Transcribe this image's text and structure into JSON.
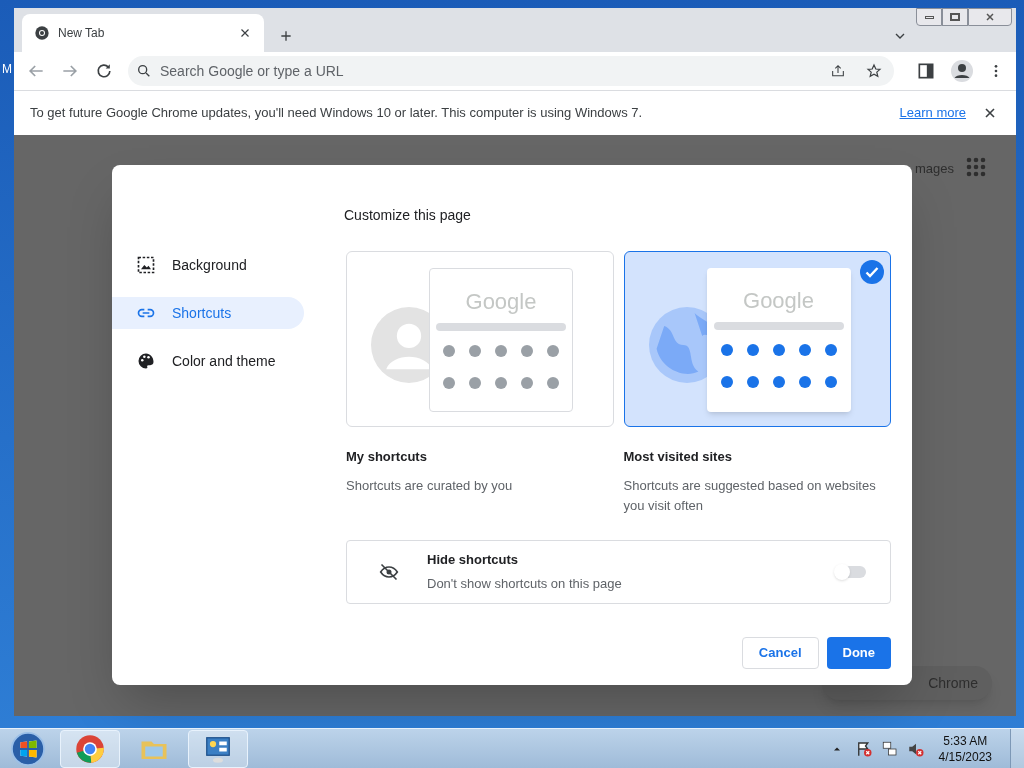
{
  "desktop": {
    "icon_label": "M"
  },
  "browser": {
    "tabs": [
      {
        "title": "New Tab",
        "selected": true
      }
    ],
    "omnibox": {
      "placeholder": "Search Google or type a URL"
    },
    "infobar": {
      "message": "To get future Google Chrome updates, you'll need Windows 10 or later. This computer is using Windows 7.",
      "link": "Learn more"
    }
  },
  "page": {
    "header_links": [
      "mages"
    ],
    "customize_button": "Chrome"
  },
  "dialog": {
    "title": "Customize this page",
    "nav": [
      {
        "label": "Background",
        "kind": "image",
        "selected": false
      },
      {
        "label": "Shortcuts",
        "kind": "link",
        "selected": true
      },
      {
        "label": "Color and theme",
        "kind": "palette",
        "selected": false
      }
    ],
    "options": [
      {
        "kind": "person",
        "logo_text": "Google",
        "title": "My shortcuts",
        "description": "Shortcuts are curated by you",
        "selected": false
      },
      {
        "kind": "globe",
        "logo_text": "Google",
        "title": "Most visited sites",
        "description": "Shortcuts are suggested based on websites you visit often",
        "selected": true
      }
    ],
    "toggle": {
      "title": "Hide shortcuts",
      "description": "Don't show shortcuts on this page",
      "on": false
    },
    "buttons": [
      {
        "label": "Cancel",
        "kind": "secondary"
      },
      {
        "label": "Done",
        "kind": "primary"
      }
    ]
  },
  "taskbar": {
    "time": "5:33 AM",
    "date": "4/15/2023"
  }
}
